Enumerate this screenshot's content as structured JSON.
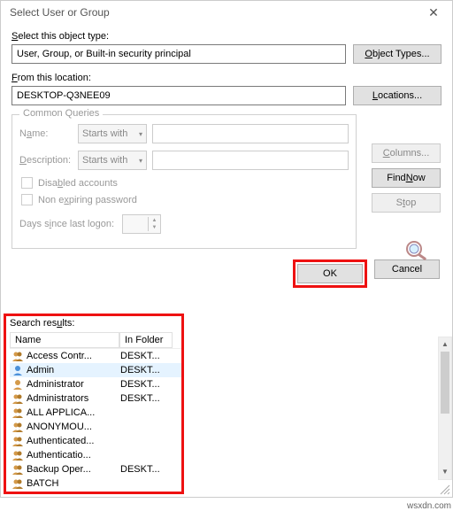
{
  "window": {
    "title": "Select User or Group"
  },
  "labels": {
    "object_type": "Select this object type:",
    "location": "From this location:",
    "search_results": "Search results:",
    "col_name": "Name",
    "col_folder": "In Folder"
  },
  "fields": {
    "object_type_value": "User, Group, or Built-in security principal",
    "location_value": "DESKTOP-Q3NEE09"
  },
  "buttons": {
    "object_types": "Object Types...",
    "locations": "Locations...",
    "columns": "Columns...",
    "find_now": "Find Now",
    "stop": "Stop",
    "ok": "OK",
    "cancel": "Cancel"
  },
  "queries": {
    "legend": "Common Queries",
    "name_label": "Name:",
    "desc_label": "Description:",
    "starts_with": "Starts with",
    "disabled_accounts": "Disabled accounts",
    "non_expiring": "Non expiring password",
    "days_since": "Days since last logon:"
  },
  "results": [
    {
      "icon": "group",
      "name": "Access Contr...",
      "folder": "DESKT..."
    },
    {
      "icon": "user",
      "name": "Admin",
      "folder": "DESKT...",
      "selected": true
    },
    {
      "icon": "user2",
      "name": "Administrator",
      "folder": "DESKT..."
    },
    {
      "icon": "group",
      "name": "Administrators",
      "folder": "DESKT..."
    },
    {
      "icon": "group",
      "name": "ALL APPLICA...",
      "folder": ""
    },
    {
      "icon": "group",
      "name": "ANONYMOU...",
      "folder": ""
    },
    {
      "icon": "group",
      "name": "Authenticated...",
      "folder": ""
    },
    {
      "icon": "group",
      "name": "Authenticatio...",
      "folder": ""
    },
    {
      "icon": "group",
      "name": "Backup Oper...",
      "folder": "DESKT..."
    },
    {
      "icon": "group",
      "name": "BATCH",
      "folder": ""
    }
  ],
  "watermark": "wsxdn.com"
}
